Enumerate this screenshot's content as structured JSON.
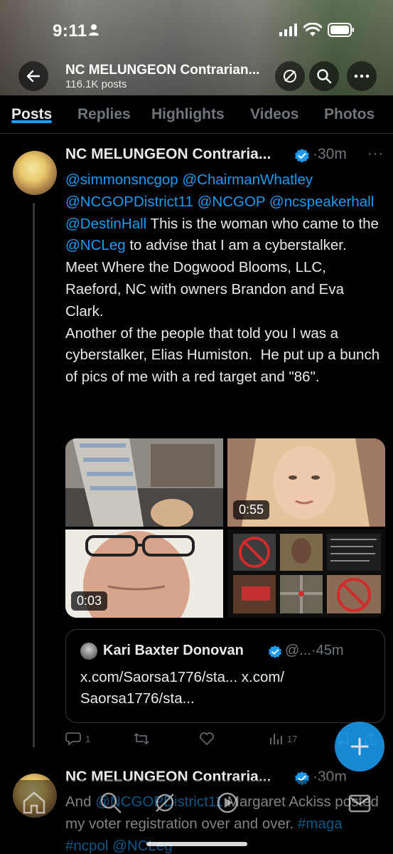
{
  "status_bar": {
    "time": "9:11"
  },
  "header": {
    "title": "NC MELUNGEON Contrarian...",
    "post_count": "116.1K posts"
  },
  "tabs": [
    {
      "label": "Posts",
      "active": true
    },
    {
      "label": "Replies",
      "active": false
    },
    {
      "label": "Highlights",
      "active": false
    },
    {
      "label": "Videos",
      "active": false
    },
    {
      "label": "Photos",
      "active": false
    }
  ],
  "post1": {
    "author": "NC MELUNGEON Contraria...",
    "time": "·30m",
    "more": "···",
    "segments": [
      {
        "text": "@simmonsncgop @ChairmanWhatley @NCGOPDistrict11 @NCGOP @ncspeakerhall @DestinHall",
        "mention": true
      },
      {
        "text": " This is the woman who came to the ",
        "mention": false
      },
      {
        "text": "@NCLeg",
        "mention": true
      },
      {
        "text": " to advise that I am a cyberstalker.\nMeet Where the Dogwood Blooms, LLC, Raeford, NC with owners Brandon and Eva Clark.\nAnother of the people that told you I was a cyberstalker, Elias Humiston.  He put up a bunch of pics of me with a red target and \"86\".",
        "mention": false
      }
    ],
    "media": [
      {
        "duration": ""
      },
      {
        "duration": "0:55"
      },
      {
        "duration": "0:03"
      },
      {
        "duration": ""
      }
    ],
    "quote": {
      "author": "Kari Baxter Donovan",
      "handle": "@...·45m",
      "text": "x.com/Saorsa1776/sta... x.com/\nSaorsa1776/sta..."
    },
    "actions": {
      "replies": "1",
      "reposts": "",
      "likes": "",
      "views": "17"
    }
  },
  "post2": {
    "author": "NC MELUNGEON Contraria...",
    "time": "·30m",
    "segments": [
      {
        "text": "And ",
        "mention": false
      },
      {
        "text": "@NCGOPDistrict11",
        "mention": true
      },
      {
        "text": " Margaret Ackiss posted my voter registration over and over. ",
        "mention": false
      },
      {
        "text": "#maga #ncpol @NCLeg",
        "mention": true
      }
    ]
  },
  "colors": {
    "accent": "#1d9bf0",
    "text": "#e7e9ea",
    "muted": "#71767b",
    "background": "#000000"
  },
  "icons": [
    "back-arrow-icon",
    "no-sound-icon",
    "search-icon",
    "more-icon",
    "verified-icon",
    "reply-icon",
    "repost-icon",
    "like-icon",
    "views-icon",
    "bookmark-icon",
    "share-icon",
    "plus-icon",
    "home-icon",
    "grok-icon",
    "spaces-icon",
    "mail-icon"
  ]
}
